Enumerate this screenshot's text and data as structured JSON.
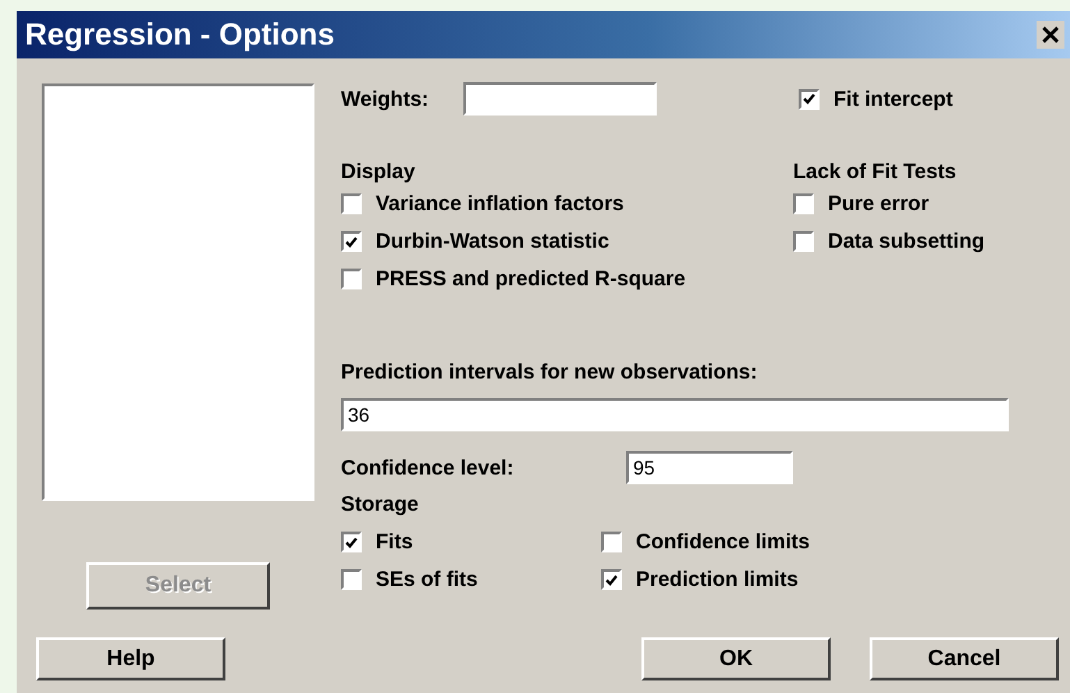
{
  "window": {
    "title": "Regression - Options"
  },
  "select_button": {
    "label": "Select",
    "disabled": true
  },
  "weights": {
    "label": "Weights:"
  },
  "fit_intercept": {
    "label": "Fit intercept",
    "checked": true
  },
  "display": {
    "title": "Display",
    "options": [
      {
        "label": "Variance inflation factors",
        "checked": false
      },
      {
        "label": "Durbin-Watson statistic",
        "checked": true
      },
      {
        "label": "PRESS and predicted R-square",
        "checked": false
      }
    ]
  },
  "lack_of_fit": {
    "title": "Lack of Fit Tests",
    "options": [
      {
        "label": "Pure error",
        "checked": false
      },
      {
        "label": "Data subsetting",
        "checked": false
      }
    ]
  },
  "prediction": {
    "label": "Prediction intervals for new observations:",
    "value": "36"
  },
  "confidence": {
    "label": "Confidence level:",
    "value": "95"
  },
  "storage": {
    "title": "Storage",
    "options": [
      {
        "label": "Fits",
        "checked": true
      },
      {
        "label": "Confidence limits",
        "checked": false
      },
      {
        "label": "SEs of fits",
        "checked": false
      },
      {
        "label": "Prediction limits",
        "checked": true
      }
    ]
  },
  "buttons": [
    {
      "label": "Help"
    },
    {
      "label": "OK"
    },
    {
      "label": "Cancel"
    }
  ]
}
